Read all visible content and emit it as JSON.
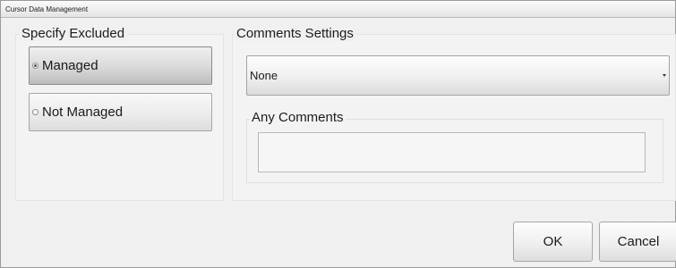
{
  "window": {
    "title": "Cursor Data Management"
  },
  "excluded": {
    "heading": "Specify Excluded",
    "options": [
      {
        "label": "Managed",
        "selected": true
      },
      {
        "label": "Not Managed",
        "selected": false
      }
    ]
  },
  "comments": {
    "heading": "Comments Settings",
    "dropdown_value": "None",
    "any_comments_label": "Any Comments",
    "any_comments_value": ""
  },
  "actions": {
    "ok_label": "OK",
    "cancel_label": "Cancel"
  }
}
